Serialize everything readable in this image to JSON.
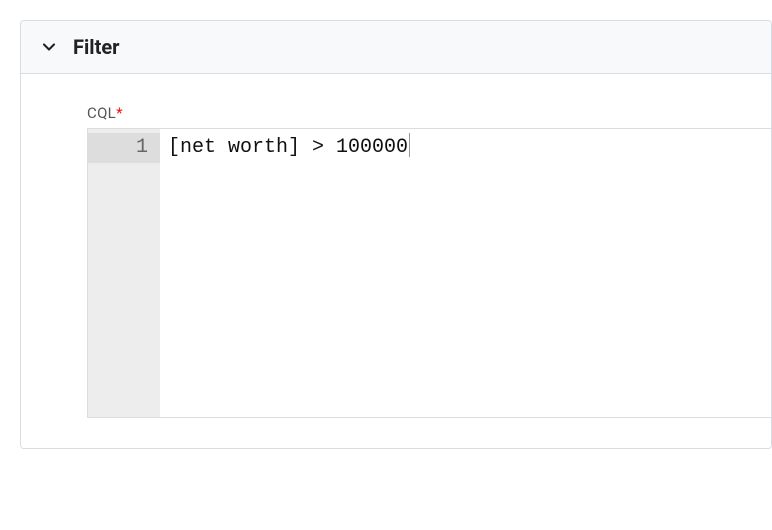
{
  "panel": {
    "title": "Filter"
  },
  "field": {
    "label": "CQL",
    "required_mark": "*"
  },
  "editor": {
    "lines": [
      {
        "number": "1",
        "text": "[net worth] > 100000"
      }
    ]
  }
}
